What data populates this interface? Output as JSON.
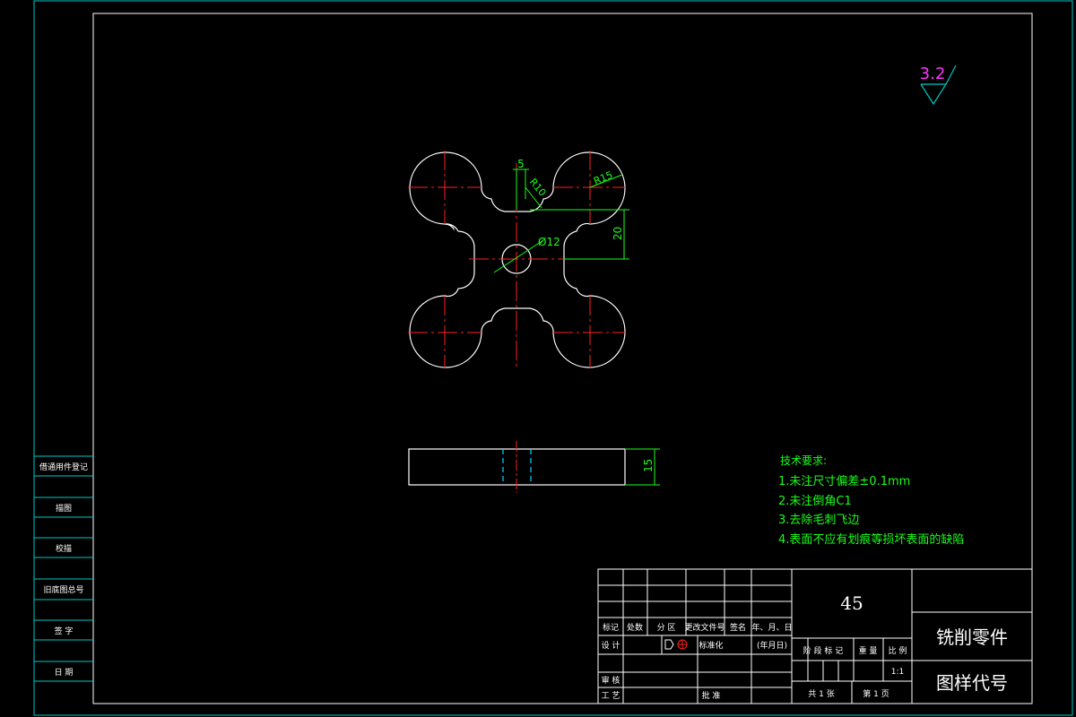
{
  "surface_finish": {
    "value": "3.2"
  },
  "dimensions": {
    "d5": "5",
    "r10": "R10",
    "r15": "R15",
    "d20": "20",
    "dia12": "Ø12",
    "d15": "15"
  },
  "tech_requirements": {
    "title": "技术要求:",
    "items": [
      "1.未注尺寸偏差±0.1mm",
      "2.未注倒角C1",
      "3.去除毛刺飞边",
      "4.表面不应有划痕等损坏表面的缺陷"
    ]
  },
  "side_stamp": {
    "labels": [
      "借通用件登记",
      "描图",
      "校描",
      "旧底图总号",
      "签 字",
      "日 期"
    ]
  },
  "title_block": {
    "material": "45",
    "part_name": "铣削零件",
    "drawing_code": "图样代号",
    "header_row": [
      "标记",
      "处数",
      "分 区",
      "更改文件号",
      "签名",
      "年、月、日"
    ],
    "design": "设 计",
    "standardize": "标准化",
    "date_hint": "(年月日)",
    "stage_row": [
      "阶 段 标 记",
      "重 量",
      "比 例"
    ],
    "scale": "1:1",
    "review": "审 核",
    "process": "工 艺",
    "approve": "批 准",
    "sheets_total": "共 1 张",
    "sheet_no": "第 1 页"
  },
  "colors": {
    "background": "#000000",
    "outline": "#ffffff",
    "centerline": "#ff2020",
    "dimension": "#19ff19",
    "frame": "#00c8c8",
    "finish_symbol": "#ff33ff",
    "hidden_line": "#00d8ff"
  }
}
